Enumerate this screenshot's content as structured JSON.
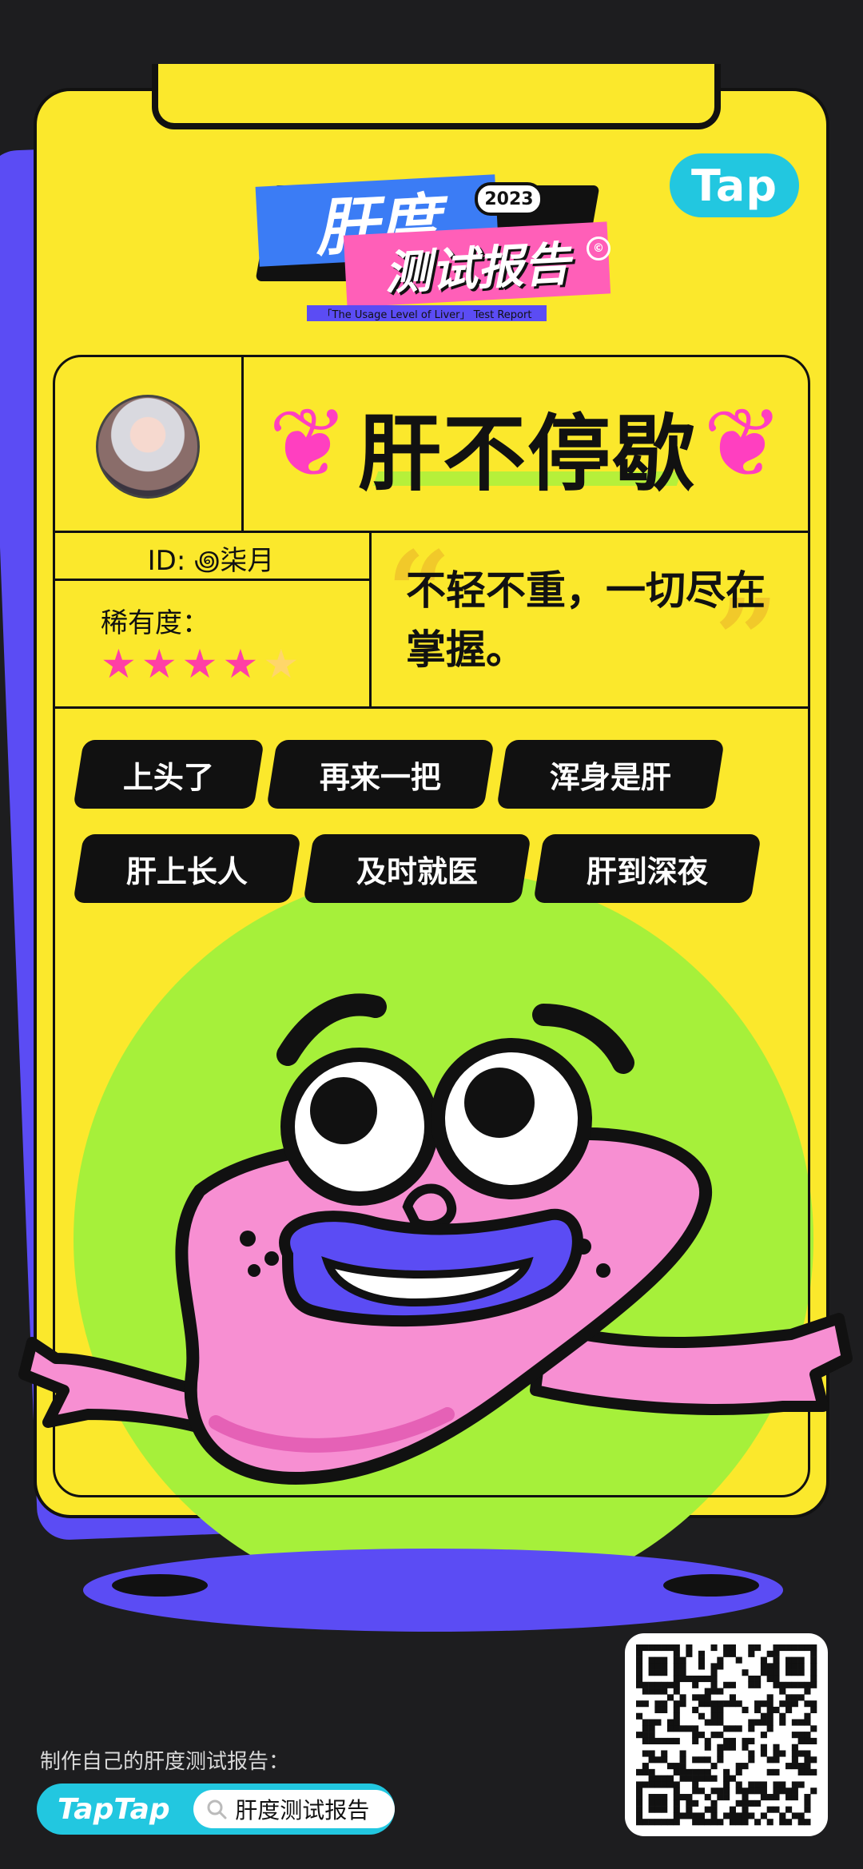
{
  "brand": {
    "tap_badge": "Tap",
    "logo_line1": "肝度",
    "logo_year": "2023",
    "logo_line2": "测试报告",
    "logo_subtitle": "「The Usage Level of Liver」 Test Report"
  },
  "card": {
    "title": "肝不停歇",
    "id_text": "ID: ꩜柒月",
    "rarity_label": "稀有度：",
    "rarity": {
      "filled": 4,
      "total": 5
    },
    "quote": "不轻不重，一切尽在掌握。",
    "tags_row1": [
      "上头了",
      "再来一把",
      "浑身是肝"
    ],
    "tags_row2": [
      "肝上长人",
      "及时就医",
      "肝到深夜"
    ]
  },
  "footer": {
    "label": "制作自己的肝度测试报告：",
    "brand": "TapTap",
    "search_text": "肝度测试报告"
  },
  "colors": {
    "card_yellow": "#fbe82c",
    "purple": "#5b4cf4",
    "cyan": "#22c7e0",
    "pink": "#ff5fb8",
    "green": "#a6f03a",
    "liver_pink": "#f78fd2"
  }
}
